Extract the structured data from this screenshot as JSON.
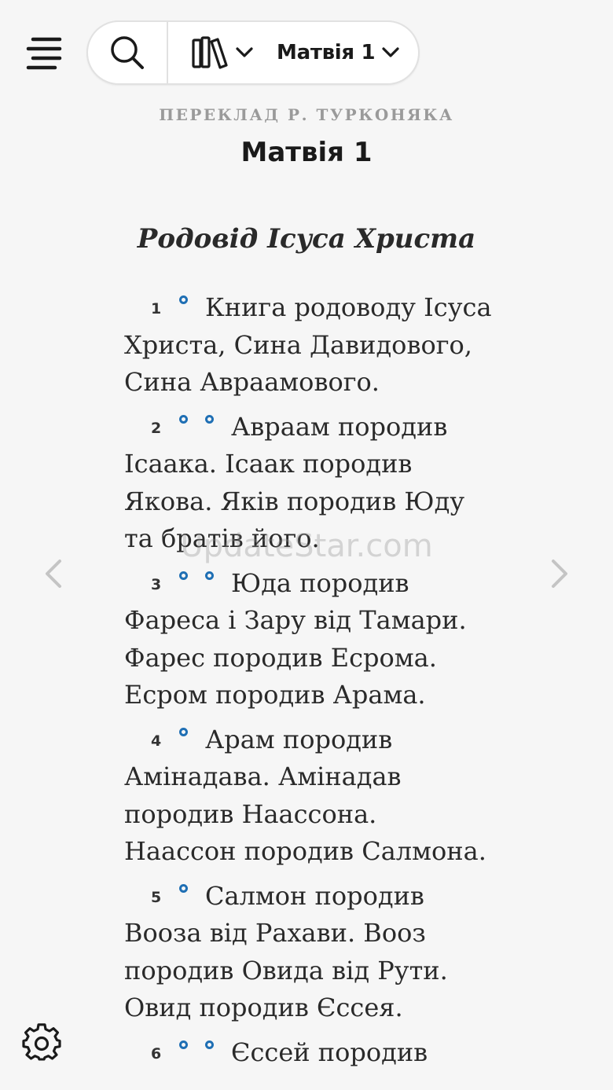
{
  "toolbar": {
    "book_chapter": "Матвія 1"
  },
  "header": {
    "version": "ПЕРЕКЛАД Р. ТУРКОНЯКА",
    "chapter_title": "Матвія 1"
  },
  "content": {
    "section_heading": "Родовід Ісуса Христа",
    "verses": [
      {
        "num": "1",
        "text": "Книга родоводу Ісуса Христа, Сина Давидового, Сина Авраамового."
      },
      {
        "num": "2",
        "text": "Авраам породив Ісаака. Ісаак породив Якова. Яків породив Юду та братів його."
      },
      {
        "num": "3",
        "text": "Юда породив Фареса і Зару від Тамари. Фарес породив Есрома. Есром породив Арама."
      },
      {
        "num": "4",
        "text": "Арам породив Амінадава. Амінадав породив Наассона. Наассон породив Салмона."
      },
      {
        "num": "5",
        "text": "Салмон породив Вооза від Рахави. Вооз породив Овида від Рути. Овид породив Єссея."
      },
      {
        "num": "6",
        "text": "Єссей породив"
      }
    ]
  },
  "watermark": "UpdateStar.com",
  "icons": {
    "menu": "menu-icon",
    "search": "search-icon",
    "library": "library-icon",
    "chevron": "chevron-down-icon",
    "prev": "chevron-left-icon",
    "next": "chevron-right-icon",
    "settings": "gear-icon"
  },
  "colors": {
    "accent": "#1f6fb4",
    "background": "#f6f6f6"
  }
}
